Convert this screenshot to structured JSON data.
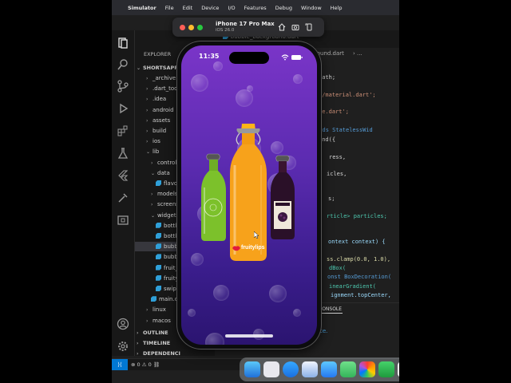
{
  "menubar": {
    "app": "Simulator",
    "items": [
      "File",
      "Edit",
      "Device",
      "I/O",
      "Features",
      "Debug",
      "Window",
      "Help"
    ]
  },
  "vscode": {
    "explorer_title": "EXPLORER",
    "project": "SHORTSAPP",
    "tree": [
      {
        "label": "_archive",
        "type": "folder"
      },
      {
        "label": ".dart_tool",
        "type": "folder"
      },
      {
        "label": ".idea",
        "type": "folder"
      },
      {
        "label": "android",
        "type": "folder"
      },
      {
        "label": "assets",
        "type": "folder"
      },
      {
        "label": "build",
        "type": "folder"
      },
      {
        "label": "ios",
        "type": "folder"
      },
      {
        "label": "lib",
        "type": "folder-open"
      },
      {
        "label": "controllers",
        "type": "folder"
      },
      {
        "label": "data",
        "type": "folder-open"
      },
      {
        "label": "flavors",
        "type": "file"
      },
      {
        "label": "models",
        "type": "folder"
      },
      {
        "label": "screens",
        "type": "folder"
      },
      {
        "label": "widgets",
        "type": "folder-open"
      },
      {
        "label": "bottle",
        "type": "file"
      },
      {
        "label": "bottle",
        "type": "file"
      },
      {
        "label": "bubble",
        "type": "file-selected"
      },
      {
        "label": "bubble",
        "type": "file"
      },
      {
        "label": "fruit_",
        "type": "file"
      },
      {
        "label": "fruityl",
        "type": "file"
      },
      {
        "label": "swipe",
        "type": "file"
      },
      {
        "label": "main.da",
        "type": "file"
      },
      {
        "label": "linux",
        "type": "folder"
      },
      {
        "label": "macos",
        "type": "folder"
      }
    ],
    "outline": "OUTLINE",
    "timeline": "TIMELINE",
    "dependencies": "DEPENDENCI",
    "tab": "bubble_background.dart",
    "breadcrumb": "round.dart",
    "code_lines": [
      "math;",
      "r/material.dart';",
      "le.dart';",
      "d extends StatelessWid",
      "und({",
      "ress,",
      "icles,",
      "s;",
      "rticle> particles;",
      "ontext context) {",
      "ss.clamp(0.0, 1.0),",
      "dBox(",
      "onst BoxDecoration(",
      "inearGradient(",
      "ignment.topCenter,"
    ],
    "panel_tab": "CONSOLE",
    "panel_text": "ce.",
    "status_errors": "0",
    "status_warnings": "0"
  },
  "simulator": {
    "device": "iPhone 17 Pro Max",
    "os": "iOS 26.0"
  },
  "phone": {
    "time": "11:35",
    "brand": "fruitylips"
  },
  "dock": {
    "calendar_day": "21"
  },
  "colors": {
    "accent": "#0078d4",
    "screen_top": "#7a35c8",
    "screen_bottom": "#2b1470",
    "orange_juice": "#f7a21b",
    "kiwi": "#7cc12b",
    "blackberry": "#2a1028"
  }
}
